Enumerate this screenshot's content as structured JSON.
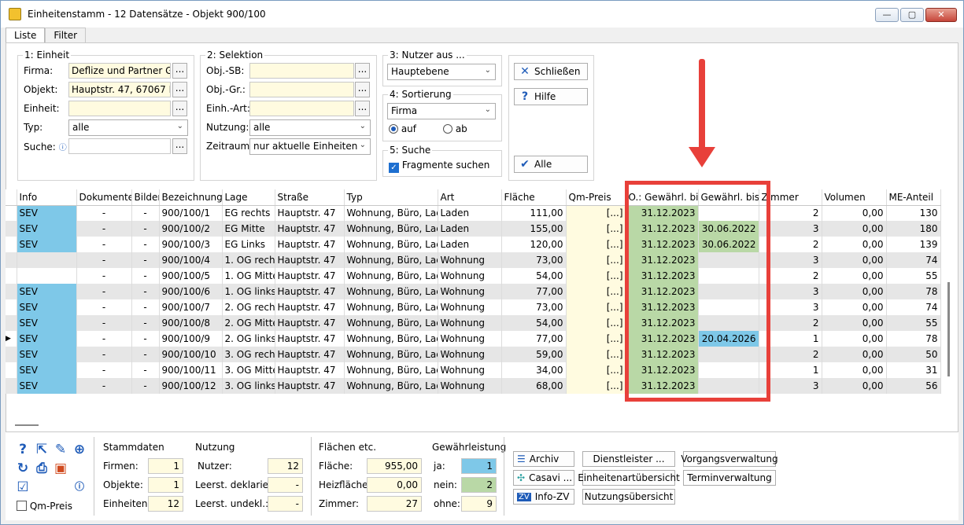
{
  "window": {
    "title": "Einheitenstamm - 12 Datensätze - Objekt 900/100",
    "buttons": {
      "minimize": "—",
      "maximize": "▢",
      "close": "✕"
    }
  },
  "tabs": [
    {
      "label": "Liste"
    },
    {
      "label": "Filter"
    }
  ],
  "einheit": {
    "title": "1: Einheit",
    "firma_label": "Firma:",
    "firma_value": "Deflize und Partner GmbH",
    "objekt_label": "Objekt:",
    "objekt_value": "Hauptstr. 47, 67067 Ludwigshafen",
    "einheit_label": "Einheit:",
    "einheit_value": "",
    "typ_label": "Typ:",
    "typ_value": "alle",
    "suche_label": "Suche:",
    "suche_value": "",
    "dots": "..."
  },
  "selektion": {
    "title": "2: Selektion",
    "objsb_label": "Obj.-SB:",
    "objgr_label": "Obj.-Gr.:",
    "einhart_label": "Einh.-Art:",
    "nutzung_label": "Nutzung:",
    "nutzung_value": "alle",
    "zeitraum_label": "Zeitraum:",
    "zeitraum_value": "nur aktuelle Einheiten"
  },
  "nutzer": {
    "title": "3: Nutzer aus ...",
    "value": "Hauptebene"
  },
  "sortierung": {
    "title": "4: Sortierung",
    "value": "Firma",
    "auf": "auf",
    "ab": "ab"
  },
  "suche": {
    "title": "5: Suche",
    "fragmente": "Fragmente suchen"
  },
  "actions": {
    "schliessen": "Schließen",
    "hilfe": "Hilfe",
    "alle": "Alle"
  },
  "table": {
    "columns": [
      "Info",
      "Dokumente",
      "Bilder",
      "Bezeichnung",
      "Lage",
      "Straße",
      "Typ",
      "Art",
      "Fläche",
      "Qm-Preis",
      "O.: Gewährl. bis",
      "Gewährl. bis",
      "Zimmer",
      "Volumen",
      "ME-Anteil"
    ],
    "rows": [
      {
        "info": "SEV",
        "dok": "-",
        "bild": "-",
        "bez": "900/100/1",
        "lage": "EG rechts",
        "str": "Hauptstr. 47",
        "typ": "Wohnung, Büro, Laden",
        "art": "Laden",
        "flaeche": "111,00",
        "qm": "[...]",
        "og": "31.12.2023",
        "gw": "",
        "zimmer": "2",
        "volumen": "0,00",
        "me": "130"
      },
      {
        "info": "SEV",
        "dok": "-",
        "bild": "-",
        "bez": "900/100/2",
        "lage": "EG Mitte",
        "str": "Hauptstr. 47",
        "typ": "Wohnung, Büro, Laden",
        "art": "Laden",
        "flaeche": "155,00",
        "qm": "[...]",
        "og": "31.12.2023",
        "gw": "30.06.2022",
        "zimmer": "3",
        "volumen": "0,00",
        "me": "180"
      },
      {
        "info": "SEV",
        "dok": "-",
        "bild": "-",
        "bez": "900/100/3",
        "lage": "EG Links",
        "str": "Hauptstr. 47",
        "typ": "Wohnung, Büro, Laden",
        "art": "Laden",
        "flaeche": "120,00",
        "qm": "[...]",
        "og": "31.12.2023",
        "gw": "30.06.2022",
        "zimmer": "2",
        "volumen": "0,00",
        "me": "139"
      },
      {
        "info": "",
        "dok": "-",
        "bild": "-",
        "bez": "900/100/4",
        "lage": "1. OG rechts",
        "str": "Hauptstr. 47",
        "typ": "Wohnung, Büro, Laden",
        "art": "Wohnung",
        "flaeche": "73,00",
        "qm": "[...]",
        "og": "31.12.2023",
        "gw": "",
        "zimmer": "3",
        "volumen": "0,00",
        "me": "74"
      },
      {
        "info": "",
        "dok": "-",
        "bild": "-",
        "bez": "900/100/5",
        "lage": "1. OG Mitte",
        "str": "Hauptstr. 47",
        "typ": "Wohnung, Büro, Laden",
        "art": "Wohnung",
        "flaeche": "54,00",
        "qm": "[...]",
        "og": "31.12.2023",
        "gw": "",
        "zimmer": "2",
        "volumen": "0,00",
        "me": "55"
      },
      {
        "info": "SEV",
        "dok": "-",
        "bild": "-",
        "bez": "900/100/6",
        "lage": "1. OG links",
        "str": "Hauptstr. 47",
        "typ": "Wohnung, Büro, Laden",
        "art": "Wohnung",
        "flaeche": "77,00",
        "qm": "[...]",
        "og": "31.12.2023",
        "gw": "",
        "zimmer": "3",
        "volumen": "0,00",
        "me": "78"
      },
      {
        "info": "SEV",
        "dok": "-",
        "bild": "-",
        "bez": "900/100/7",
        "lage": "2. OG rechts",
        "str": "Hauptstr. 47",
        "typ": "Wohnung, Büro, Laden",
        "art": "Wohnung",
        "flaeche": "73,00",
        "qm": "[...]",
        "og": "31.12.2023",
        "gw": "",
        "zimmer": "3",
        "volumen": "0,00",
        "me": "74"
      },
      {
        "info": "SEV",
        "dok": "-",
        "bild": "-",
        "bez": "900/100/8",
        "lage": "2. OG Mitte",
        "str": "Hauptstr. 47",
        "typ": "Wohnung, Büro, Laden",
        "art": "Wohnung",
        "flaeche": "54,00",
        "qm": "[...]",
        "og": "31.12.2023",
        "gw": "",
        "zimmer": "2",
        "volumen": "0,00",
        "me": "55"
      },
      {
        "info": "SEV",
        "dok": "-",
        "bild": "-",
        "bez": "900/100/9",
        "lage": "2. OG links",
        "str": "Hauptstr. 47",
        "typ": "Wohnung, Büro, Laden",
        "art": "Wohnung",
        "flaeche": "77,00",
        "qm": "[...]",
        "og": "31.12.2023",
        "gw": "20.04.2026",
        "zimmer": "1",
        "volumen": "0,00",
        "me": "78"
      },
      {
        "info": "SEV",
        "dok": "-",
        "bild": "-",
        "bez": "900/100/10",
        "lage": "3. OG rechts",
        "str": "Hauptstr. 47",
        "typ": "Wohnung, Büro, Laden",
        "art": "Wohnung",
        "flaeche": "59,00",
        "qm": "[...]",
        "og": "31.12.2023",
        "gw": "",
        "zimmer": "2",
        "volumen": "0,00",
        "me": "50"
      },
      {
        "info": "SEV",
        "dok": "-",
        "bild": "-",
        "bez": "900/100/11",
        "lage": "3. OG Mitte",
        "str": "Hauptstr. 47",
        "typ": "Wohnung, Büro, Laden",
        "art": "Wohnung",
        "flaeche": "34,00",
        "qm": "[...]",
        "og": "31.12.2023",
        "gw": "",
        "zimmer": "1",
        "volumen": "0,00",
        "me": "31"
      },
      {
        "info": "SEV",
        "dok": "-",
        "bild": "-",
        "bez": "900/100/12",
        "lage": "3. OG links",
        "str": "Hauptstr. 47",
        "typ": "Wohnung, Büro, Laden",
        "art": "Wohnung",
        "flaeche": "68,00",
        "qm": "[...]",
        "og": "31.12.2023",
        "gw": "",
        "zimmer": "3",
        "volumen": "0,00",
        "me": "56"
      }
    ],
    "current_row_index": 8,
    "gw_colors": {
      "30.06.2022": "#b9d8a6",
      "20.04.2026": "#7ec8e8"
    }
  },
  "bottom": {
    "qm_preis": "Qm-Preis",
    "stammdaten": {
      "title": "Stammdaten",
      "firmen_label": "Firmen:",
      "firmen": "1",
      "objekte_label": "Objekte:",
      "objekte": "1",
      "einheiten_label": "Einheiten:",
      "einheiten": "12"
    },
    "nutzung": {
      "title": "Nutzung",
      "nutzer_label": "Nutzer:",
      "nutzer": "12",
      "dekl_label": "Leerst. deklariert:",
      "dekl": "-",
      "undekl_label": "Leerst. undekl.:",
      "undekl": "-"
    },
    "flaechen": {
      "title": "Flächen etc.",
      "flaeche_label": "Fläche:",
      "flaeche": "955,00",
      "heiz_label": "Heizfläche:",
      "heiz": "0,00",
      "zimmer_label": "Zimmer:",
      "zimmer": "27"
    },
    "gewaehr": {
      "title": "Gewährleistung",
      "ja_label": "ja:",
      "ja": "1",
      "nein_label": "nein:",
      "nein": "2",
      "ohne_label": "ohne:",
      "ohne": "9"
    },
    "buttons": {
      "archiv": "Archiv",
      "casavi": "Casavi ...",
      "infozv": "Info-ZV",
      "dienstleister": "Dienstleister ...",
      "einheitenart": "Einheitenartübersicht",
      "nutzungsuebersicht": "Nutzungsübersicht",
      "vorgangsverwaltung": "Vorgangsverwaltung",
      "terminverwaltung": "Terminverwaltung"
    }
  }
}
